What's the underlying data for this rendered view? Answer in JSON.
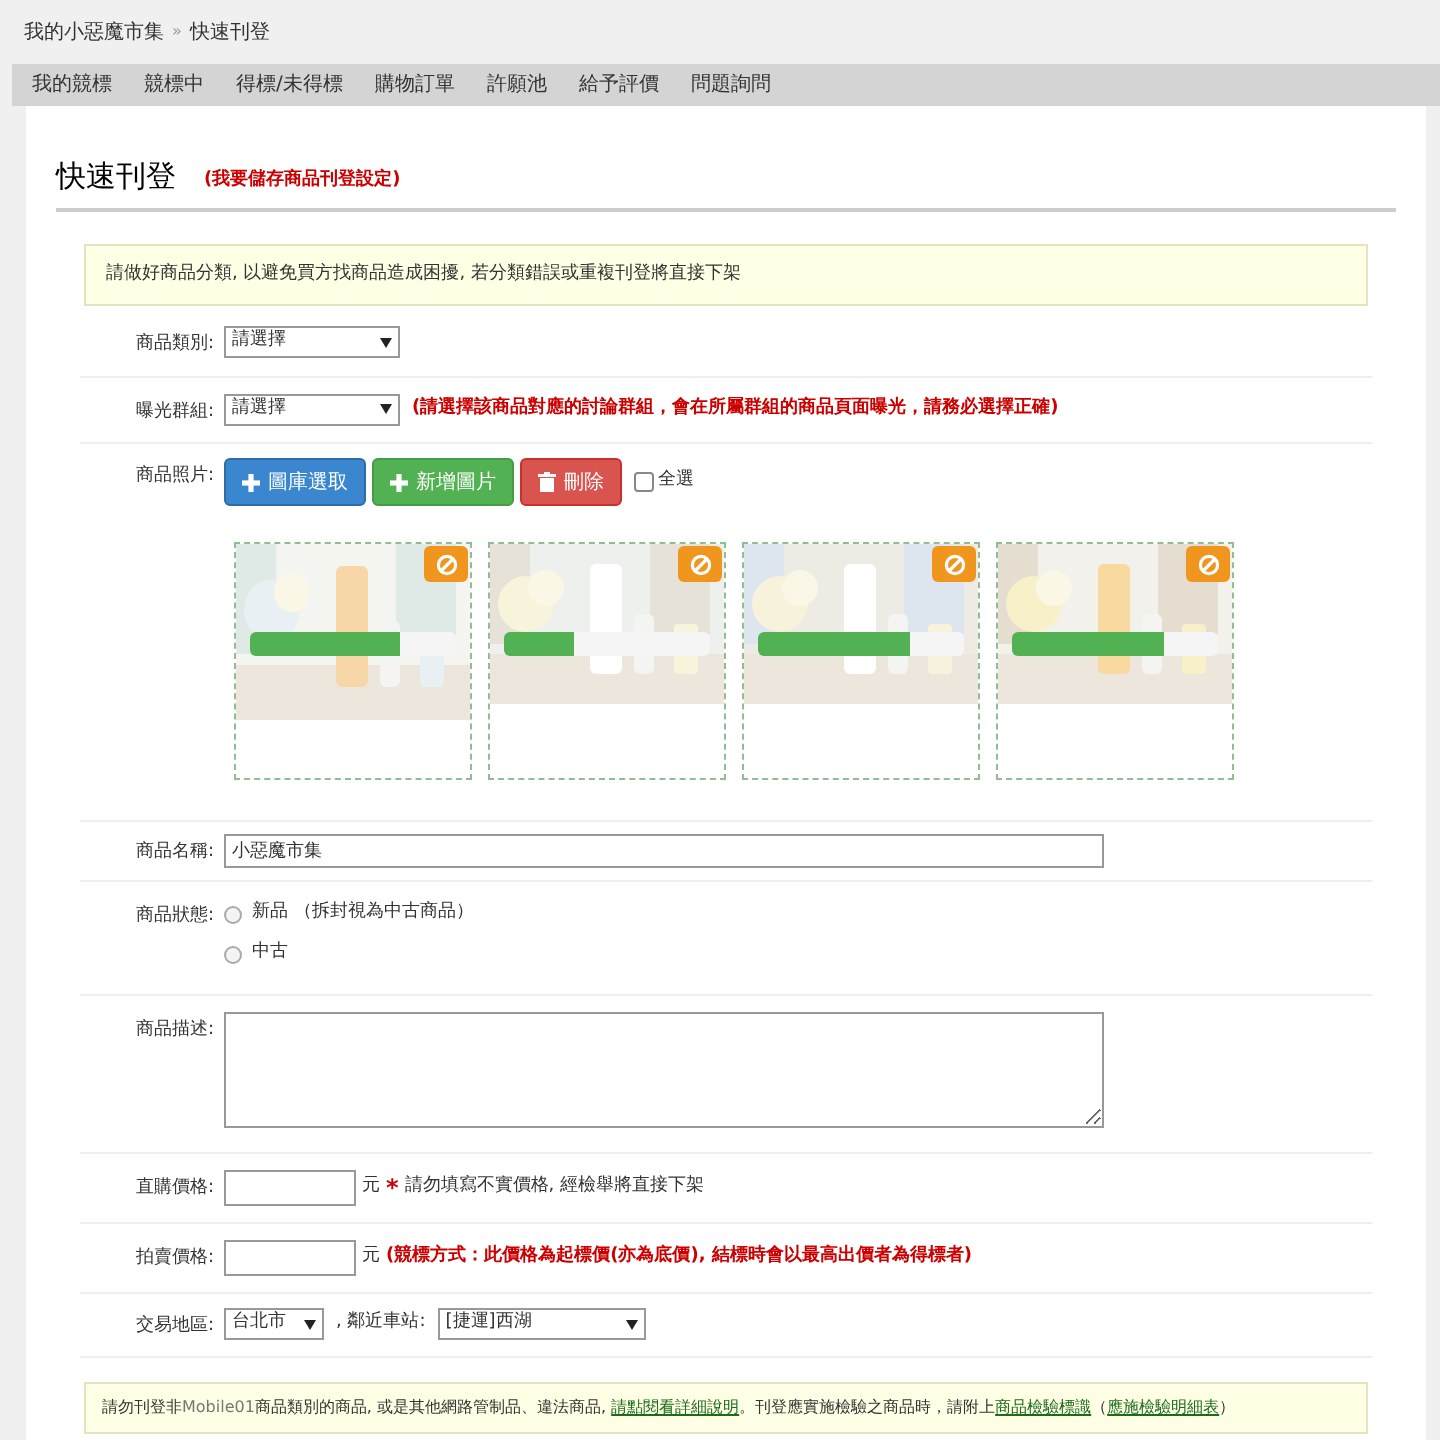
{
  "breadcrumb": [
    "我的小惡魔市集",
    "快速刊登"
  ],
  "breadcrumb_separator": "»",
  "nav": [
    "我的競標",
    "競標中",
    "得標/未得標",
    "購物訂單",
    "許願池",
    "給予評價",
    "問題詢問"
  ],
  "heading": {
    "title": "快速刊登",
    "link": "(我要儲存商品刊登設定)"
  },
  "notice": "請做好商品分類, 以避免買方找商品造成困擾, 若分類錯誤或重複刊登將直接下架",
  "category": {
    "label": "商品類別:",
    "value": "請選擇"
  },
  "group": {
    "label": "曝光群組:",
    "value": "請選擇",
    "hint": "(請選擇該商品對應的討論群組，會在所屬群組的商品頁面曝光，請務必選擇正確)"
  },
  "photos": {
    "label": "商品照片:",
    "buttons": [
      {
        "kind": "gallery",
        "label": "圖庫選取"
      },
      {
        "kind": "add",
        "label": "新增圖片"
      },
      {
        "kind": "delete",
        "label": "刪除"
      }
    ],
    "select_all": {
      "label": "全選",
      "checked": false
    },
    "items": [
      {
        "kind": "picture",
        "level": 0.73
      },
      {
        "kind": "picture",
        "level": 0.34
      },
      {
        "kind": "picture",
        "level": 0.74
      },
      {
        "kind": "picture",
        "level": 0.74
      }
    ]
  },
  "name": {
    "label": "商品名稱:",
    "value": "小惡魔市集"
  },
  "condition": {
    "label": "商品狀態:",
    "options": [
      {
        "label": "新品 （拆封視為中古商品）",
        "selected": false
      },
      {
        "label": "中古",
        "selected": false
      }
    ]
  },
  "description": {
    "label": "商品描述:"
  },
  "buy_price": {
    "label": "直購價格:",
    "unit": "元",
    "mark": "*",
    "note": "請勿填寫不實價格, 經檢舉將直接下架"
  },
  "auction_price": {
    "label": "拍賣價格:",
    "unit": "元",
    "note": "(競標方式：此價格為起標價(亦為底價), 結標時會以最高出價者為得標者)"
  },
  "region": {
    "label": "交易地區:",
    "city": "台北市",
    "station_label": ", 鄰近車站:",
    "station": "[捷運]西湖"
  },
  "footer_notice": {
    "text_1": "請勿刊登非",
    "brand": "Mobile01",
    "text_2": "商品類別的商品, 或是其他網路管制品、違法商品, ",
    "link_1": "請點閱看詳細說明",
    "text_3": "。刊登應實施檢驗之商品時，請附上",
    "link_2": "商品檢驗標識",
    "text_4": "（",
    "link_3": "應施檢驗明細表",
    "text_5": "）"
  }
}
